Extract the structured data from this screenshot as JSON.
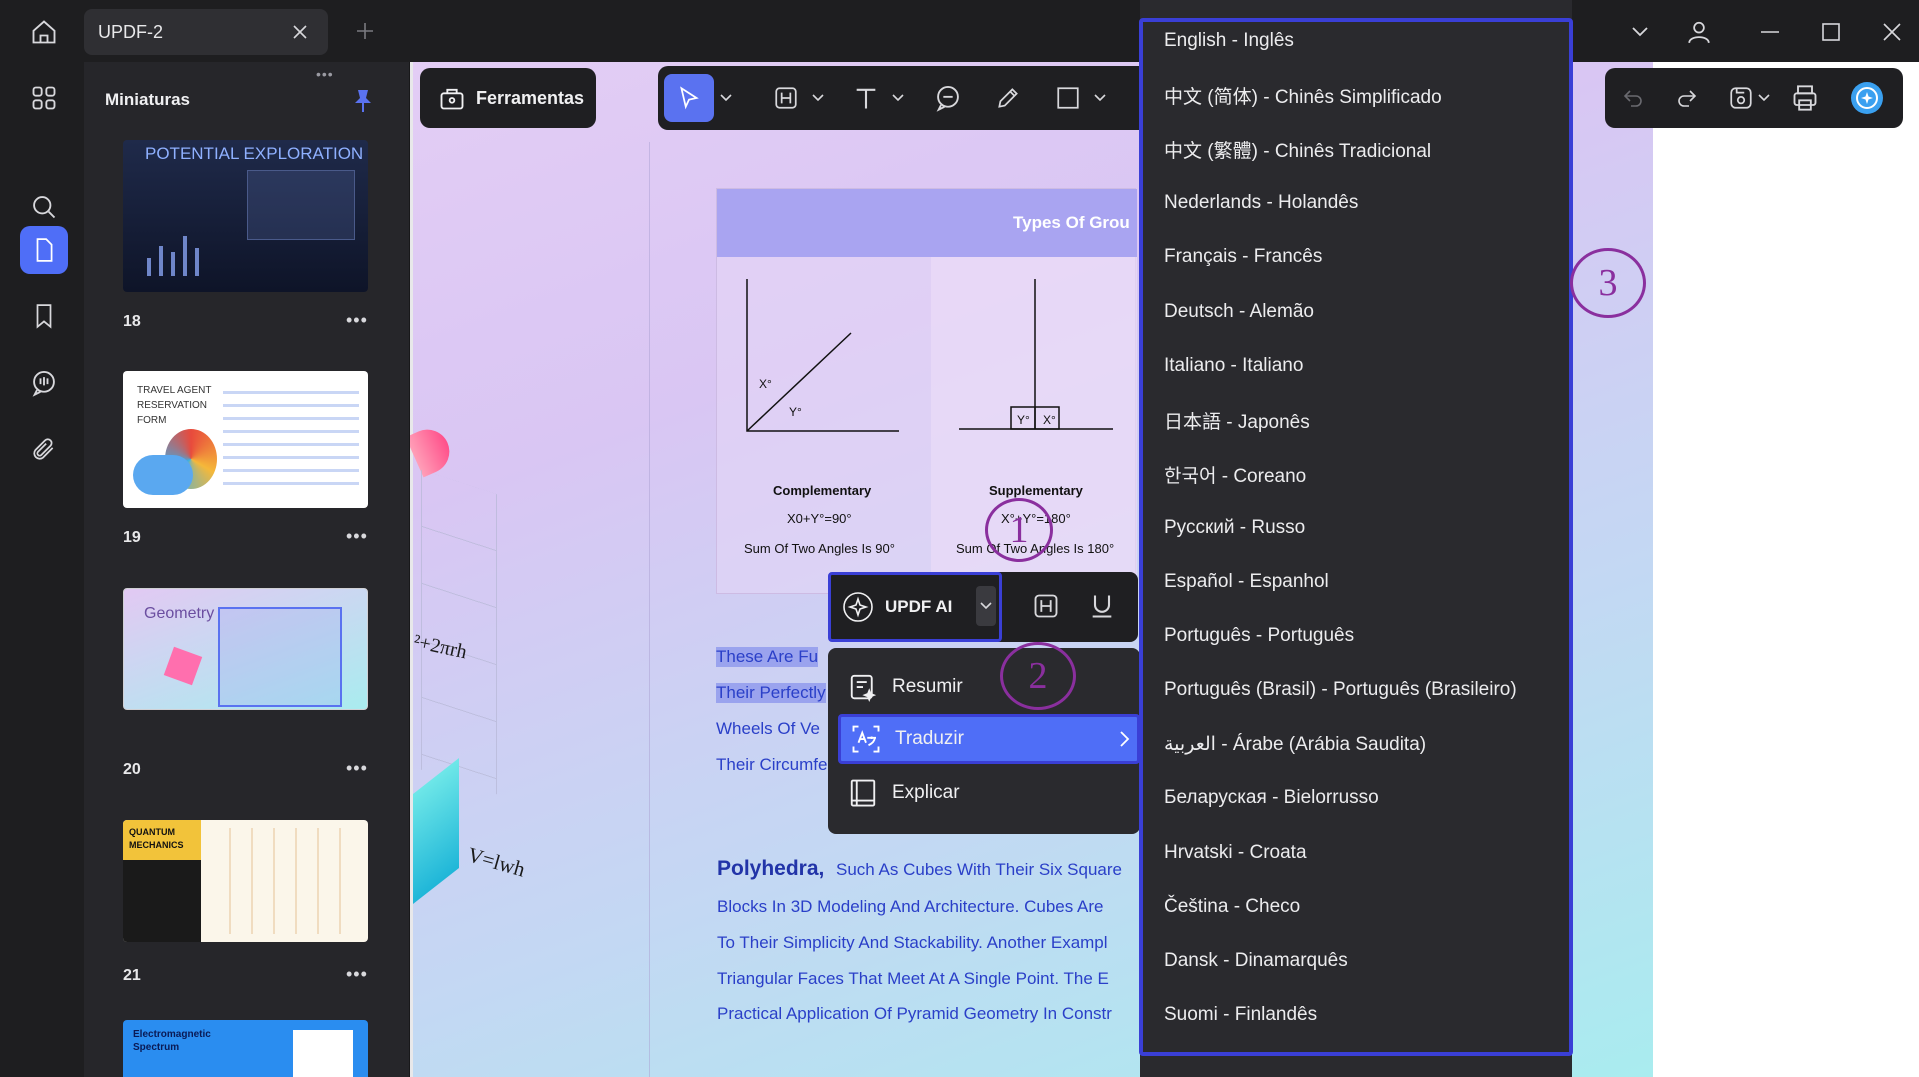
{
  "titlebar": {
    "tab_title": "UPDF-2"
  },
  "thumbnails": {
    "title": "Miniaturas",
    "grip": "•••",
    "items": [
      {
        "page": "18",
        "text": "POTENTIAL EXPLORATION"
      },
      {
        "page": "19",
        "text": "TRAVEL AGENT RESERVATION FORM"
      },
      {
        "page": "20",
        "text": "Geometry"
      },
      {
        "page": "21",
        "text": "QUANTUM MECHANICS"
      },
      {
        "page": "",
        "text": "Electromagnetic Spectrum"
      }
    ],
    "more": "•••"
  },
  "toolbar": {
    "tools_label": "Ferramentas"
  },
  "page": {
    "figure_title": "Types Of Grou",
    "complementary": "Complementary",
    "complementary_formula": "X0+Y°=90°",
    "complementary_desc": "Sum Of Two Angles Is 90°",
    "supplementary": "Supplementary",
    "supplementary_formula": "X°+Y°=180°",
    "supplementary_desc": "Sum Of Two Angles Is 180°",
    "x_deg": "X°",
    "y_deg": "Y°",
    "formula_area": "²+2πrh",
    "formula_volume": "V=lwh",
    "lines": [
      "These Are Fu",
      "Their Perfectly",
      "Wheels Of Ve",
      "Their Circumfe"
    ],
    "poly_title": "Polyhedra,",
    "poly_lines": [
      "Such As Cubes With Their Six Square",
      "Blocks In 3D Modeling And Architecture. Cubes Are",
      "To Their Simplicity And Stackability. Another Exampl",
      "Triangular Faces That Meet At A Single Point. The E",
      "Practical Application Of Pyramid Geometry In Constr"
    ]
  },
  "selection_toolbar": {
    "ai_label": "UPDF AI"
  },
  "ai_menu": {
    "items": [
      {
        "label": "Resumir"
      },
      {
        "label": "Traduzir"
      },
      {
        "label": "Explicar"
      }
    ]
  },
  "languages": [
    "English - Inglês",
    "中文 (简体) - Chinês Simplificado",
    "中文 (繁體) - Chinês Tradicional",
    "Nederlands - Holandês",
    "Français - Francês",
    "Deutsch - Alemão",
    "Italiano - Italiano",
    "日本語 - Japonês",
    "한국어 - Coreano",
    "Русский - Russo",
    "Español - Espanhol",
    "Português - Português",
    "Português (Brasil) - Português (Brasileiro)",
    "العربية - Árabe (Arábia Saudita)",
    "Беларуская - Bielorrusso",
    "Hrvatski - Croata",
    "Čeština - Checo",
    "Dansk - Dinamarquês",
    "Suomi - Finlandês"
  ],
  "steps": [
    "1",
    "2",
    "3"
  ],
  "colors": {
    "accent": "#4f6ef7",
    "highlight_frame": "#3a3fd6",
    "step_circle": "#8a2f9e",
    "panel": "#26262a",
    "menu": "#2a2a2e"
  }
}
